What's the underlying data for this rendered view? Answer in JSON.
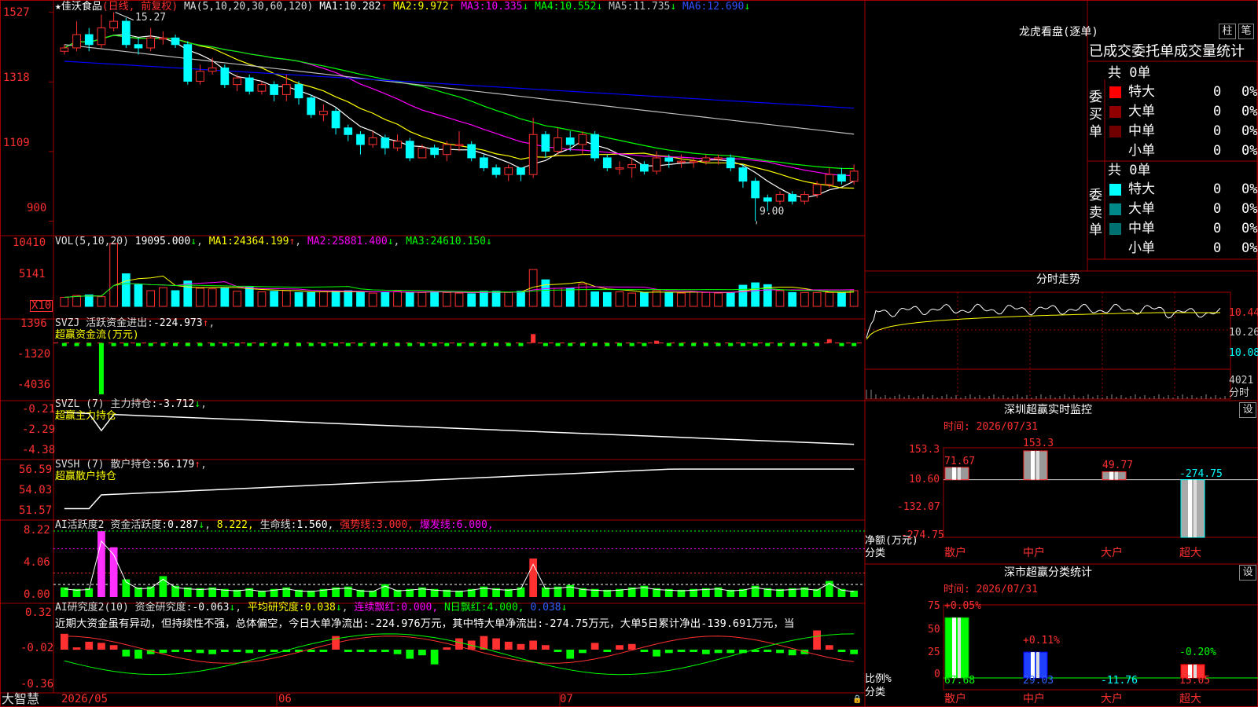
{
  "colors": {
    "up": "#ff3030",
    "down": "#00ffff",
    "ma1": "#ffffff",
    "ma2": "#ffff00",
    "ma3": "#ff00ff",
    "ma4": "#00ff00",
    "ma5": "#c0c0c0",
    "ma6": "#0000ff",
    "grid": "#a00000",
    "text": "#c8c8c8",
    "yellow": "#ffff00",
    "green": "#00ff00"
  },
  "main": {
    "star": "★",
    "stock_name": "佳沃食品",
    "period": "(日线, 前复权)",
    "ma_label": "MA(5,10,20,30,60,120)",
    "ma": [
      {
        "name": "MA1:",
        "value": "10.282",
        "arrow": "↑"
      },
      {
        "name": "MA2:",
        "value": "9.972",
        "arrow": "↑"
      },
      {
        "name": "MA3:",
        "value": "10.335",
        "arrow": "↓"
      },
      {
        "name": "MA4:",
        "value": "10.552",
        "arrow": "↓"
      },
      {
        "name": "MA5:",
        "value": "11.735",
        "arrow": "↓"
      },
      {
        "name": "MA6:",
        "value": "12.690",
        "arrow": "↓"
      }
    ],
    "y_ticks": [
      "1527",
      "1318",
      "1109",
      "900"
    ],
    "high_label": "15.27",
    "low_label": "9.00"
  },
  "candles": [
    [
      14.1,
      14.2,
      14.3,
      14.0
    ],
    [
      14.2,
      14.6,
      15.0,
      14.1
    ],
    [
      14.6,
      14.3,
      14.8,
      14.1
    ],
    [
      14.3,
      14.8,
      15.2,
      14.2
    ],
    [
      14.8,
      15.0,
      15.27,
      14.7
    ],
    [
      15.0,
      14.3,
      15.1,
      14.2
    ],
    [
      14.3,
      14.2,
      14.5,
      14.0
    ],
    [
      14.2,
      14.5,
      14.8,
      14.1
    ],
    [
      14.5,
      14.5,
      14.7,
      14.3
    ],
    [
      14.5,
      14.3,
      14.6,
      14.2
    ],
    [
      14.3,
      13.2,
      14.4,
      13.1
    ],
    [
      13.2,
      13.5,
      13.7,
      13.1
    ],
    [
      13.5,
      13.6,
      13.9,
      13.4
    ],
    [
      13.6,
      13.1,
      13.7,
      13.0
    ],
    [
      13.1,
      13.3,
      13.4,
      12.9
    ],
    [
      13.3,
      12.9,
      13.4,
      12.8
    ],
    [
      12.9,
      13.1,
      13.2,
      12.8
    ],
    [
      13.1,
      12.8,
      13.2,
      12.6
    ],
    [
      12.8,
      13.1,
      13.4,
      12.6
    ],
    [
      13.1,
      12.7,
      13.2,
      12.5
    ],
    [
      12.7,
      12.2,
      12.8,
      12.1
    ],
    [
      12.2,
      12.3,
      12.5,
      12.0
    ],
    [
      12.3,
      11.8,
      12.4,
      11.6
    ],
    [
      11.8,
      11.6,
      11.9,
      11.4
    ],
    [
      11.6,
      11.3,
      11.7,
      11.0
    ],
    [
      11.3,
      11.5,
      11.7,
      11.2
    ],
    [
      11.5,
      11.2,
      11.6,
      11.0
    ],
    [
      11.2,
      11.4,
      11.6,
      11.1
    ],
    [
      11.4,
      10.9,
      11.5,
      10.8
    ],
    [
      10.9,
      11.2,
      11.3,
      10.9
    ],
    [
      11.2,
      11.0,
      11.3,
      10.9
    ],
    [
      11.0,
      11.3,
      11.4,
      10.8
    ],
    [
      11.3,
      11.3,
      11.7,
      11.1
    ],
    [
      11.3,
      10.9,
      11.4,
      10.8
    ],
    [
      10.9,
      10.6,
      11.0,
      10.5
    ],
    [
      10.6,
      10.4,
      10.7,
      10.3
    ],
    [
      10.4,
      10.6,
      10.7,
      10.2
    ],
    [
      10.6,
      10.4,
      10.6,
      10.2
    ],
    [
      10.4,
      11.6,
      12.1,
      10.3
    ],
    [
      11.6,
      11.1,
      11.7,
      10.9
    ],
    [
      11.1,
      11.5,
      11.8,
      11.0
    ],
    [
      11.5,
      11.3,
      11.7,
      11.1
    ],
    [
      11.3,
      11.6,
      11.7,
      11.0
    ],
    [
      11.6,
      10.9,
      11.7,
      10.8
    ],
    [
      10.9,
      10.6,
      11.0,
      10.5
    ],
    [
      10.6,
      10.6,
      10.8,
      10.4
    ],
    [
      10.6,
      10.7,
      10.9,
      10.3
    ],
    [
      10.7,
      10.5,
      10.8,
      10.4
    ],
    [
      10.5,
      10.9,
      11.1,
      10.4
    ],
    [
      10.9,
      10.8,
      11.0,
      10.6
    ],
    [
      10.8,
      10.8,
      11.0,
      10.6
    ],
    [
      10.8,
      10.8,
      10.9,
      10.6
    ],
    [
      10.8,
      10.9,
      11.0,
      10.7
    ],
    [
      10.9,
      10.9,
      11.0,
      10.7
    ],
    [
      10.9,
      10.6,
      11.0,
      10.5
    ],
    [
      10.6,
      10.2,
      10.7,
      10.0
    ],
    [
      10.2,
      9.7,
      10.3,
      9.0
    ],
    [
      9.7,
      9.6,
      9.8,
      9.3
    ],
    [
      9.6,
      9.8,
      9.9,
      9.5
    ],
    [
      9.8,
      9.6,
      9.9,
      9.5
    ],
    [
      9.6,
      9.8,
      9.9,
      9.5
    ],
    [
      9.8,
      10.1,
      10.2,
      9.7
    ],
    [
      10.1,
      10.4,
      10.6,
      10.0
    ],
    [
      10.4,
      10.2,
      10.6,
      10.1
    ],
    [
      10.2,
      10.5,
      10.7,
      10.1
    ]
  ],
  "vol": {
    "header_name": "VOL(5,10,20)",
    "header_value": "19095.000",
    "header_arrow": "↓",
    "ma": [
      {
        "name": "MA1:",
        "value": "24364.199",
        "arrow": "↑"
      },
      {
        "name": "MA2:",
        "value": "25881.400",
        "arrow": "↓"
      },
      {
        "name": "MA3:",
        "value": "24610.150",
        "arrow": "↓"
      }
    ],
    "y_ticks": [
      "10410",
      "5141"
    ],
    "unit_label": "X10",
    "values": [
      1500,
      1800,
      1900,
      1600,
      10410,
      5400,
      3600,
      2600,
      3100,
      2600,
      4200,
      3000,
      2900,
      3000,
      2500,
      3200,
      2400,
      2500,
      2600,
      2300,
      2300,
      2400,
      2500,
      2600,
      2300,
      2200,
      2400,
      2500,
      2300,
      2300,
      2500,
      2300,
      2200,
      2100,
      2500,
      2500,
      2300,
      2500,
      6100,
      4400,
      3000,
      3000,
      3700,
      2400,
      2300,
      2400,
      2200,
      2300,
      2600,
      2300,
      2200,
      2400,
      2300,
      2200,
      2300,
      3500,
      3900,
      3600,
      2600,
      2300,
      2300,
      2300,
      2300,
      2300,
      2600
    ]
  },
  "svzj": {
    "header_name": "SVZJ",
    "header_label": "活跃资金进出:",
    "header_value": "-224.973",
    "header_arrow": "↑",
    "subtitle": "超赢资金流(万元)",
    "y_ticks": [
      "1396",
      "-1320",
      "-4036"
    ],
    "values": [
      -150,
      -100,
      -120,
      -4036,
      -80,
      -90,
      -110,
      -120,
      -100,
      -90,
      -80,
      -100,
      -120,
      -150,
      -110,
      -90,
      -100,
      -80,
      -90,
      -100,
      -90,
      -120,
      -100,
      -90,
      -80,
      -100,
      -150,
      -90,
      -80,
      -100,
      -110,
      -90,
      -80,
      -100,
      -90,
      -90,
      -100,
      -110,
      700,
      -90,
      -80,
      -100,
      -90,
      -110,
      -80,
      -90,
      -100,
      -80,
      180,
      -90,
      -100,
      -80,
      -90,
      -110,
      -100,
      -80,
      -90,
      -100,
      -80,
      -110,
      -90,
      -100,
      300,
      -90,
      -100
    ]
  },
  "svzl": {
    "header_name": "SVZL",
    "header_params": "(7)",
    "header_label": "主力持仓:",
    "header_value": "-3.712",
    "header_arrow": "↓",
    "subtitle": "超赢主力持仓",
    "y_ticks": [
      "-0.21",
      "-2.29",
      "-4.38"
    ]
  },
  "svsh": {
    "header_name": "SVSH",
    "header_params": "(7)",
    "header_label": "散户持仓:",
    "header_value": "56.179",
    "header_arrow": "↑",
    "subtitle": "超赢散户持仓",
    "y_ticks": [
      "56.59",
      "54.03",
      "51.57"
    ]
  },
  "ai_act": {
    "header_name": "AI活跃度2",
    "header_label": "资金活跃度:",
    "header_value": "0.287",
    "header_arrow": "↓",
    "extra": "8.222,",
    "life_label": "生命线:",
    "life_value": "1.560,",
    "strong_label": "强势线:",
    "strong_value": "3.000,",
    "burst_label": "爆发线:",
    "burst_value": "6.000,",
    "y_ticks": [
      "8.22",
      "4.06",
      "0.00"
    ],
    "values": [
      1.2,
      1.0,
      1.1,
      8.2,
      6.2,
      2.2,
      1.2,
      1.3,
      2.6,
      1.4,
      1.2,
      1.1,
      1.2,
      1.0,
      0.9,
      1.1,
      0.8,
      1.0,
      1.2,
      0.9,
      0.8,
      1.0,
      1.2,
      1.3,
      0.9,
      0.8,
      1.6,
      0.9,
      1.0,
      1.2,
      1.0,
      0.9,
      0.8,
      1.0,
      1.3,
      1.1,
      1.0,
      1.2,
      4.8,
      1.2,
      1.3,
      1.5,
      1.1,
      1.0,
      0.9,
      1.0,
      1.2,
      1.4,
      1.1,
      1.0,
      0.9,
      1.0,
      1.1,
      1.2,
      0.9,
      1.0,
      1.4,
      1.1,
      1.0,
      1.1,
      1.2,
      1.0,
      2.0,
      1.0,
      0.8
    ]
  },
  "ai_res": {
    "header_name": "AI研究度2(10)",
    "header_label": "资金研究度:",
    "header_value": "-0.063",
    "header_arrow": "↓",
    "avg_label": "平均研究度:",
    "avg_value": "0.038",
    "avg_arrow": "↓",
    "red_label": "连续飘红:",
    "red_value": "0.000,",
    "nday_label": "N日飘红:",
    "nday_value": "4.000,",
    "tail_value": "0.038",
    "tail_arrow": "↓",
    "y_ticks": [
      "0.32",
      "-0.02",
      "-0.36"
    ],
    "comment": "近期大资金虽有异动，但持续性不强，总体偏空，今日大单净流出:-224.976万元，其中特大单净流出:-274.75万元，大单5日累计净出-139.691万元，当",
    "values": [
      0.12,
      0.0,
      0.05,
      0.04,
      0.02,
      -0.08,
      -0.1,
      -0.06,
      -0.05,
      -0.03,
      -0.04,
      -0.05,
      -0.06,
      -0.04,
      -0.03,
      -0.05,
      -0.04,
      -0.03,
      -0.02,
      -0.03,
      -0.04,
      -0.02,
      0.1,
      -0.02,
      -0.03,
      -0.02,
      -0.04,
      -0.06,
      -0.1,
      -0.07,
      -0.15,
      0.0,
      0.08,
      0.06,
      0.1,
      0.08,
      0.05,
      0.03,
      0.06,
      0.02,
      -0.03,
      -0.1,
      -0.05,
      0.04,
      -0.02,
      0.02,
      0.03,
      -0.04,
      -0.08,
      -0.05,
      -0.04,
      -0.03,
      -0.06,
      -0.05,
      -0.05,
      -0.05,
      -0.04,
      -0.02,
      -0.05,
      -0.07,
      -0.06,
      0.15,
      0.02,
      -0.04,
      -0.06
    ]
  },
  "x_axis": {
    "labels": [
      "2026/05",
      "06",
      "07"
    ],
    "logo": "大智慧"
  },
  "longhu": {
    "title": "龙虎看盘(逐单)",
    "btn1": "柱",
    "btn2": "笔",
    "subtitle": "已成交委托单成交量统计",
    "buy": {
      "side_label": "委买单",
      "total": "共 0单",
      "rows": [
        {
          "name": "特大",
          "count": "0",
          "pct": "0%",
          "color": "#ff0000"
        },
        {
          "name": "大单",
          "count": "0",
          "pct": "0%",
          "color": "#900000"
        },
        {
          "name": "中单",
          "count": "0",
          "pct": "0%",
          "color": "#700000"
        },
        {
          "name": "小单",
          "count": "0",
          "pct": "0%",
          "color": "#000000"
        }
      ]
    },
    "sell": {
      "side_label": "委卖单",
      "total": "共 0单",
      "rows": [
        {
          "name": "特大",
          "count": "0",
          "pct": "0%",
          "color": "#00ffff"
        },
        {
          "name": "大单",
          "count": "0",
          "pct": "0%",
          "color": "#008888"
        },
        {
          "name": "中单",
          "count": "0",
          "pct": "0%",
          "color": "#007070"
        },
        {
          "name": "小单",
          "count": "0",
          "pct": "0%",
          "color": "#000000"
        }
      ]
    }
  },
  "intraday": {
    "title": "分时走势",
    "price_ticks": [
      "10.44",
      "10.26",
      "10.08"
    ],
    "vol_tick": "4021",
    "unit": "分时"
  },
  "sz_monitor": {
    "title": "深圳超赢实时监控",
    "btn": "设",
    "time": "时间: 2026/07/31",
    "y_ticks": [
      "153.3",
      "10.60",
      "-132.07",
      "-274.75"
    ],
    "ylabel": "净额(万元)",
    "xlabel": "分类",
    "categories": [
      "散户",
      "中户",
      "大户",
      "超大"
    ],
    "values": [
      71.67,
      153.3,
      49.77,
      -274.75
    ],
    "value_labels": [
      "71.67",
      "153.3",
      "49.77",
      "-274.75"
    ]
  },
  "sz_stat": {
    "title": "深市超赢分类统计",
    "btn": "设",
    "time": "时间: 2026/07/31",
    "y_ticks": [
      "75",
      "50",
      "25",
      "0"
    ],
    "ylabel": "比例%",
    "xlabel": "分类",
    "categories": [
      "散户",
      "中户",
      "大户",
      "超大"
    ],
    "values": [
      67.68,
      29.03,
      -11.76,
      15.05
    ],
    "value_labels": [
      "67.68",
      "29.03",
      "-11.76",
      "15.05"
    ],
    "delta_labels": [
      "+0.05%",
      "+0.11%",
      "",
      "-0.20%"
    ]
  },
  "chart_data": [
    {
      "type": "candlestick",
      "title": "佳沃食品 (日线, 前复权)",
      "ylim": [
        9.0,
        15.27
      ],
      "high": 15.27,
      "low": 9.0
    },
    {
      "type": "bar",
      "title": "深圳超赢实时监控",
      "categories": [
        "散户",
        "中户",
        "大户",
        "超大"
      ],
      "values": [
        71.67,
        153.3,
        49.77,
        -274.75
      ],
      "ylabel": "净额(万元)",
      "xlabel": "分类",
      "ylim": [
        -274.75,
        153.3
      ]
    },
    {
      "type": "bar",
      "title": "深市超赢分类统计",
      "categories": [
        "散户",
        "中户",
        "大户",
        "超大"
      ],
      "values": [
        67.68,
        29.03,
        -11.76,
        15.05
      ],
      "ylabel": "比例%",
      "xlabel": "分类",
      "ylim": [
        0,
        75
      ]
    }
  ]
}
